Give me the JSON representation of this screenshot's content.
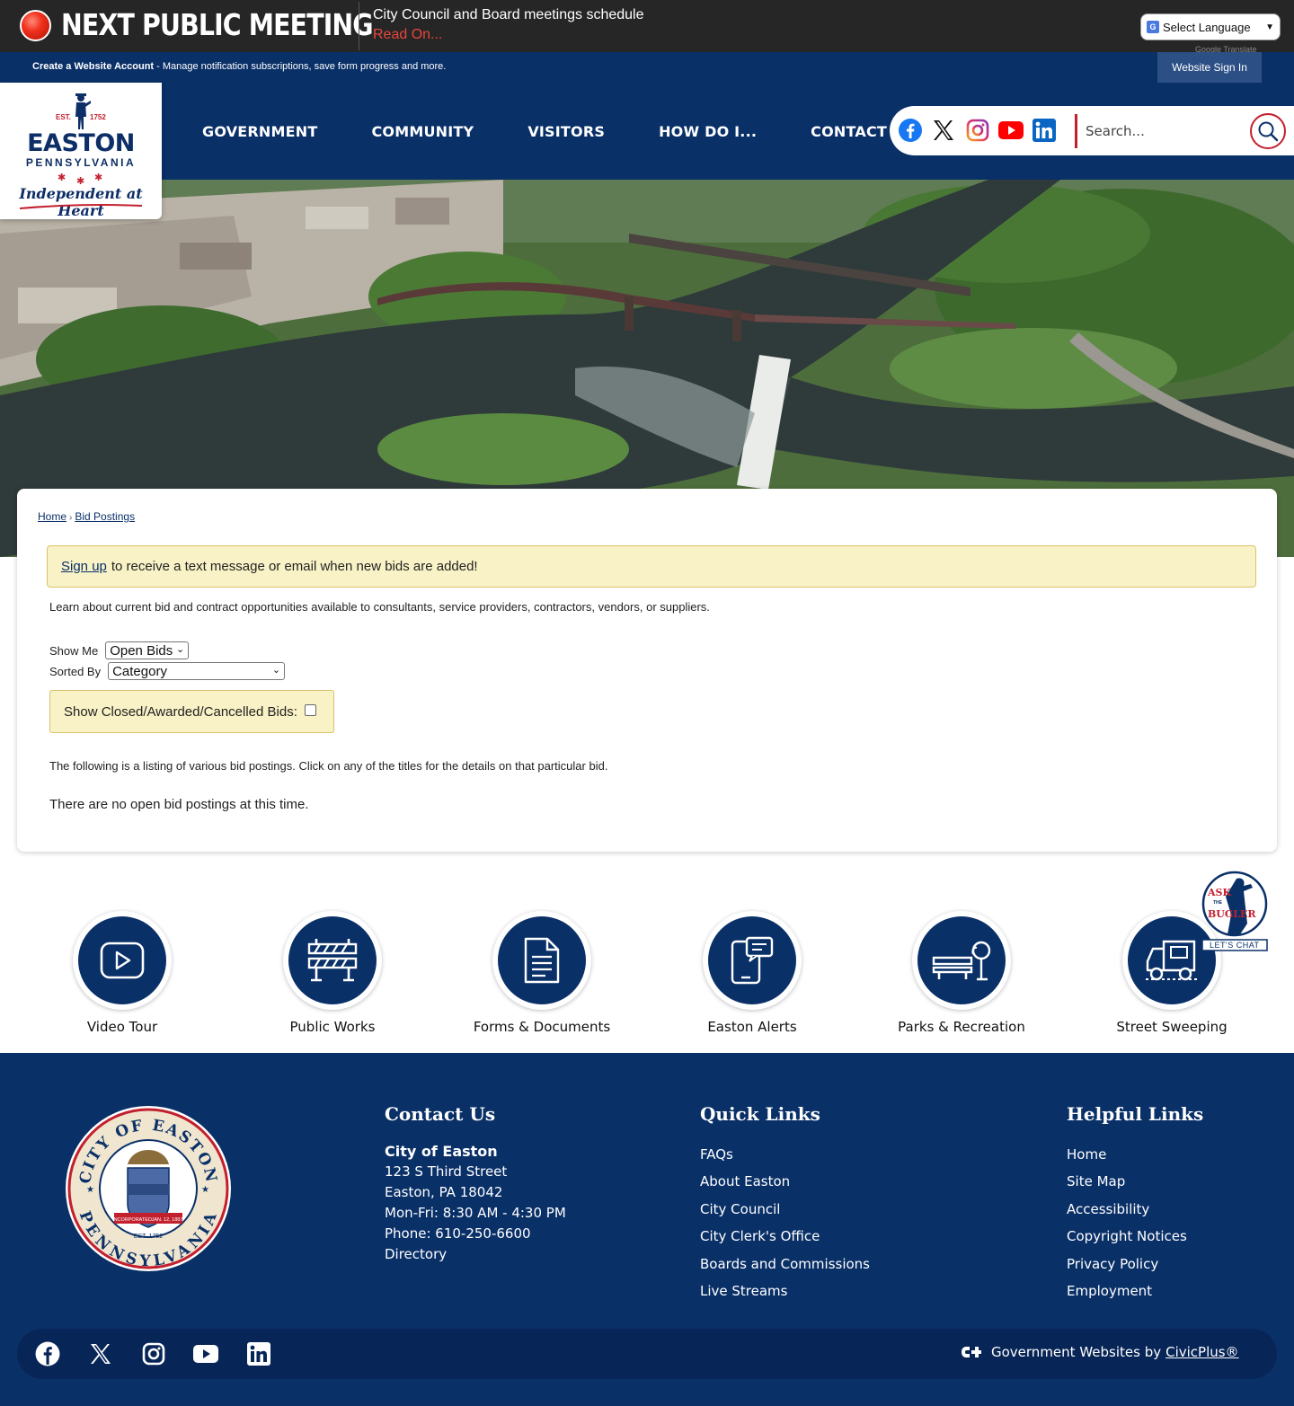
{
  "alert": {
    "heading": "NEXT PUBLIC MEETING",
    "message": "City Council and Board meetings schedule",
    "link": "Read On...",
    "language_select": "Select Language",
    "powered_by": "Google Translate"
  },
  "account": {
    "create_bold": "Create a Website Account",
    "create_rest": " - Manage notification subscriptions, save form progress and more.",
    "signin": "Website Sign In"
  },
  "logo": {
    "est_left": "EST.",
    "est_right": "1752",
    "name": "EASTON",
    "state": "PENNSYLVANIA",
    "tagline": "Independent at Heart"
  },
  "nav": {
    "items": [
      "GOVERNMENT",
      "COMMUNITY",
      "VISITORS",
      "HOW DO I...",
      "CONTACT"
    ]
  },
  "search": {
    "placeholder": "Search..."
  },
  "breadcrumb": {
    "home": "Home",
    "sep": "›",
    "current": "Bid Postings"
  },
  "notice": {
    "link": "Sign up",
    "text": "to receive a text message or email when new bids are added!"
  },
  "content": {
    "intro": "Learn about current bid and contract opportunities available to consultants, service providers, contractors, vendors, or suppliers.",
    "show_me_label": "Show Me",
    "show_me_value": "Open Bids",
    "sorted_by_label": "Sorted By",
    "sorted_by_value": "Category",
    "closed_label": "Show Closed/Awarded/Cancelled Bids:",
    "listing_note": "The following is a listing of various bid postings. Click on any of the titles for the details on that particular bid.",
    "no_bids": "There are no open bid postings at this time."
  },
  "quick_links": [
    {
      "label": "Video Tour",
      "icon": "video-play-icon"
    },
    {
      "label": "Public Works",
      "icon": "barricade-icon"
    },
    {
      "label": "Forms & Documents",
      "icon": "document-icon"
    },
    {
      "label": "Easton Alerts",
      "icon": "phone-message-icon"
    },
    {
      "label": "Parks & Recreation",
      "icon": "park-bench-icon"
    },
    {
      "label": "Street Sweeping",
      "icon": "street-sweeper-icon"
    }
  ],
  "chat": {
    "ask": "ASK",
    "the": "THE",
    "bugler": "BUGLER",
    "cta": "LET'S CHAT"
  },
  "seal": {
    "top": "CITY OF EASTON",
    "bottom": "PENNSYLVANIA",
    "incorporated": "INCORPORATED",
    "date": "JAN. 12, 1887",
    "est": "EST. 1752"
  },
  "footer": {
    "contact": {
      "title": "Contact Us",
      "name": "City of Easton",
      "lines": [
        "123 S Third Street",
        "Easton, PA 18042",
        "Mon-Fri: 8:30 AM - 4:30 PM",
        "Phone: 610-250-6600",
        "Directory"
      ]
    },
    "quick": {
      "title": "Quick Links",
      "links": [
        "FAQs",
        "About Easton",
        "City Council",
        "City Clerk's Office",
        "Boards and Commissions",
        "Live Streams"
      ]
    },
    "helpful": {
      "title": "Helpful Links",
      "links": [
        "Home",
        "Site Map",
        "Accessibility",
        "Copyright Notices",
        "Privacy Policy",
        "Employment"
      ]
    },
    "credit_prefix": "Government Websites by",
    "credit_link": "CivicPlus®"
  },
  "colors": {
    "navy": "#0a3068",
    "red": "#c3202e",
    "notice_bg": "#f9f2c6"
  }
}
